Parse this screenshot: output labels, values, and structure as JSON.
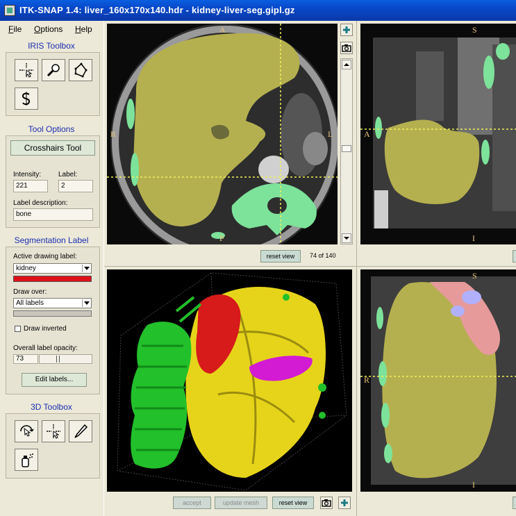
{
  "window": {
    "title": "ITK-SNAP 1.4: liver_160x170x140.hdr - kidney-liver-seg.gipl.gz"
  },
  "menu": {
    "file": "File",
    "options": "Options",
    "help": "Help"
  },
  "iris_toolbox": {
    "title": "IRIS Toolbox",
    "tools": [
      "crosshairs-tool-icon",
      "zoom-pan-tool-icon",
      "polygon-tool-icon",
      "snake-roi-tool-icon"
    ]
  },
  "tool_options": {
    "title": "Tool Options",
    "active_tool": "Crosshairs Tool",
    "intensity_label": "Intensity:",
    "intensity_value": "221",
    "label_label": "Label:",
    "label_value": "2",
    "description_label": "Label description:",
    "description_value": "bone"
  },
  "segmentation": {
    "title": "Segmentation Label",
    "active_label_caption": "Active drawing label:",
    "active_label": "kidney",
    "active_label_color": "#e0101a",
    "draw_over_caption": "Draw over:",
    "draw_over": "All labels",
    "draw_inverted": "Draw inverted",
    "opacity_caption": "Overall label opacity:",
    "opacity_value": "73",
    "edit_labels": "Edit labels..."
  },
  "toolbox3d": {
    "title": "3D Toolbox",
    "tools": [
      "rotate-tool-icon",
      "crosshair-3d-tool-icon",
      "scalpel-tool-icon",
      "spray-paint-tool-icon"
    ]
  },
  "axial": {
    "top": "A",
    "bottom": "P",
    "left": "R",
    "right": "L",
    "reset_view": "reset view",
    "slice": "74 of 140"
  },
  "coronal": {
    "top": "S",
    "bottom": "I",
    "left": "A"
  },
  "sagittal": {
    "top": "S",
    "bottom": "I",
    "left": "R"
  },
  "view3d": {
    "accept": "accept",
    "update_mesh": "update mesh",
    "reset_view": "reset view"
  },
  "colors": {
    "liver": "#b5b04f",
    "bone": "#7de29a",
    "kidney": "#e0101a",
    "spine_mesh": "#22c02a",
    "liver_mesh": "#e6d41a",
    "vessel_mesh": "#d21bd2"
  }
}
